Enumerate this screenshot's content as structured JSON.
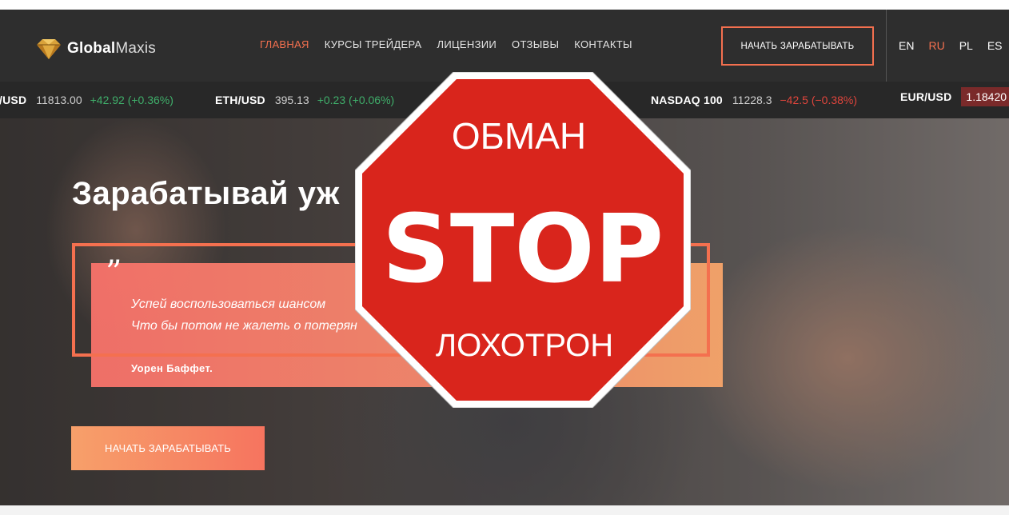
{
  "header": {
    "logo_bold": "Global",
    "logo_light": "Maxis",
    "nav": [
      {
        "label": "ГЛАВНАЯ",
        "active": true
      },
      {
        "label": "КУРСЫ ТРЕЙДЕРА",
        "active": false
      },
      {
        "label": "ЛИЦЕНЗИИ",
        "active": false
      },
      {
        "label": "ОТЗЫВЫ",
        "active": false
      },
      {
        "label": "КОНТАКТЫ",
        "active": false
      }
    ],
    "cta_label": "НАЧАТЬ ЗАРАБАТЫВАТЬ",
    "languages": [
      {
        "code": "EN",
        "active": false
      },
      {
        "code": "RU",
        "active": true
      },
      {
        "code": "PL",
        "active": false
      },
      {
        "code": "ES",
        "active": false
      }
    ]
  },
  "ticker": [
    {
      "symbol": "/USD",
      "price": "11813.00",
      "change": "+42.92 (+0.36%)",
      "direction": "up"
    },
    {
      "symbol": "ETH/USD",
      "price": "395.13",
      "change": "+0.23 (+0.06%)",
      "direction": "up"
    },
    {
      "symbol": "NASDAQ 100",
      "price": "11228.3",
      "change": "−42.5 (−0.38%)",
      "direction": "down"
    },
    {
      "symbol": "EUR/USD",
      "price": "1.18420",
      "change": "",
      "direction": "down"
    }
  ],
  "hero": {
    "title": "Зарабатывай уж",
    "quote_mark": "”",
    "quote_lines": [
      "Успей воспользоваться шансом",
      "Что бы потом не жалеть о потерян"
    ],
    "quote_author": "Уорен Баффет.",
    "cta_label": "НАЧАТЬ ЗАРАБАТЫВАТЬ"
  },
  "stop_sign": {
    "top_text": "ОБМАН",
    "main_text": "STOP",
    "bottom_text": "ЛОХОТРОН"
  },
  "colors": {
    "accent": "#f4704f",
    "header_bg": "#2e2e2e",
    "ticker_bg": "#282828",
    "stop_red": "#d9251c",
    "up": "#3fae6a",
    "down": "#e0453c"
  }
}
